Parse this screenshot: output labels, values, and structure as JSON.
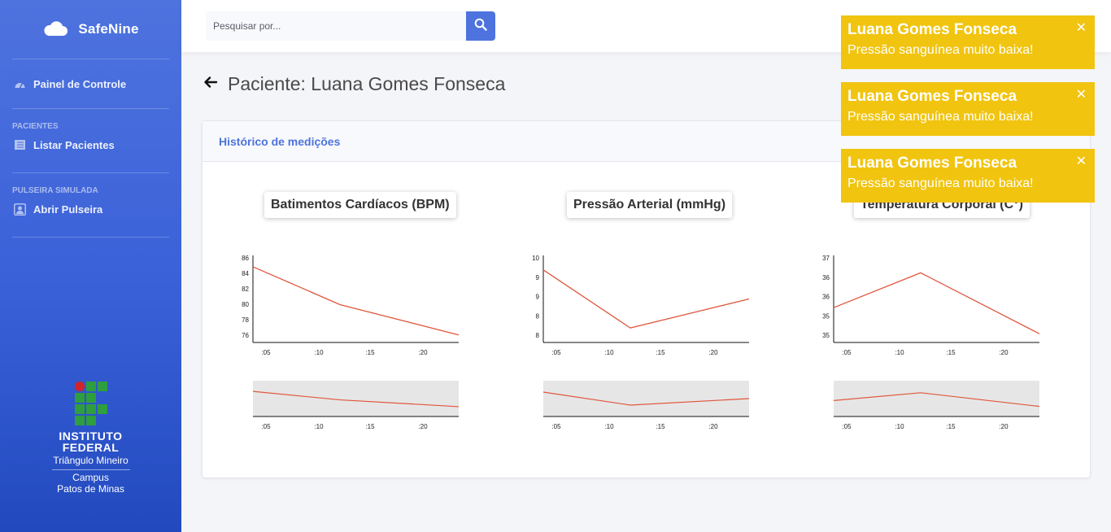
{
  "brand": {
    "name": "SafeNine",
    "icon": "cloud-icon"
  },
  "sidebar": {
    "dashboard": {
      "label": "Painel de Controle",
      "icon": "gauge-icon"
    },
    "section_patients": "PACIENTES",
    "list_patients": {
      "label": "Listar Pacientes",
      "icon": "list-icon"
    },
    "section_bracelet": "PULSEIRA SIMULADA",
    "open_bracelet": {
      "label": "Abrir Pulseira",
      "icon": "user-badge-icon"
    }
  },
  "logo": {
    "line1": "INSTITUTO",
    "line2": "FEDERAL",
    "line3": "Triângulo Mineiro",
    "line4": "Campus",
    "line5": "Patos de Minas"
  },
  "search": {
    "placeholder": "Pesquisar por...",
    "value": ""
  },
  "page": {
    "title": "Paciente: Luana Gomes Fonseca",
    "back_icon": "arrow-left-icon"
  },
  "card": {
    "header": "Histórico de medições"
  },
  "colors": {
    "primary": "#4e73df",
    "line": "#e0573c",
    "toast": "#f1c40f"
  },
  "toasts": [
    {
      "title": "Luana Gomes Fonseca",
      "message": "Pressão sanguínea muito baixa!"
    },
    {
      "title": "Luana Gomes Fonseca",
      "message": "Pressão sanguínea muito baixa!"
    },
    {
      "title": "Luana Gomes Fonseca",
      "message": "Pressão sanguínea muito baixa!"
    }
  ],
  "chart_data": [
    {
      "type": "line",
      "title": "Batimentos Cardíacos (BPM)",
      "x_ticks": [
        ":05",
        ":10",
        ":15",
        ":20"
      ],
      "y_ticks": [
        "86",
        "84",
        "82",
        "80",
        "78",
        "76"
      ],
      "series": [
        {
          "values": [
            85,
            80,
            76
          ]
        }
      ],
      "ylim": [
        75,
        86.5
      ],
      "has_navigator": true
    },
    {
      "type": "line",
      "title": "Pressão Arterial (mmHg)",
      "x_ticks": [
        ":05",
        ":10",
        ":15",
        ":20"
      ],
      "y_ticks": [
        "10",
        "9",
        "9",
        "8",
        "8"
      ],
      "series": [
        {
          "values": [
            10,
            8,
            9
          ]
        }
      ],
      "ylim": [
        7.5,
        10.5
      ],
      "has_navigator": true
    },
    {
      "type": "line",
      "title": "Temperatura Corporal (C°)",
      "x_ticks": [
        ":05",
        ":10",
        ":15",
        ":20"
      ],
      "y_ticks": [
        "37",
        "36",
        "36",
        "35",
        "35"
      ],
      "series": [
        {
          "values": [
            35.75,
            36.75,
            35
          ]
        }
      ],
      "ylim": [
        34.75,
        37.25
      ],
      "has_navigator": true
    }
  ]
}
